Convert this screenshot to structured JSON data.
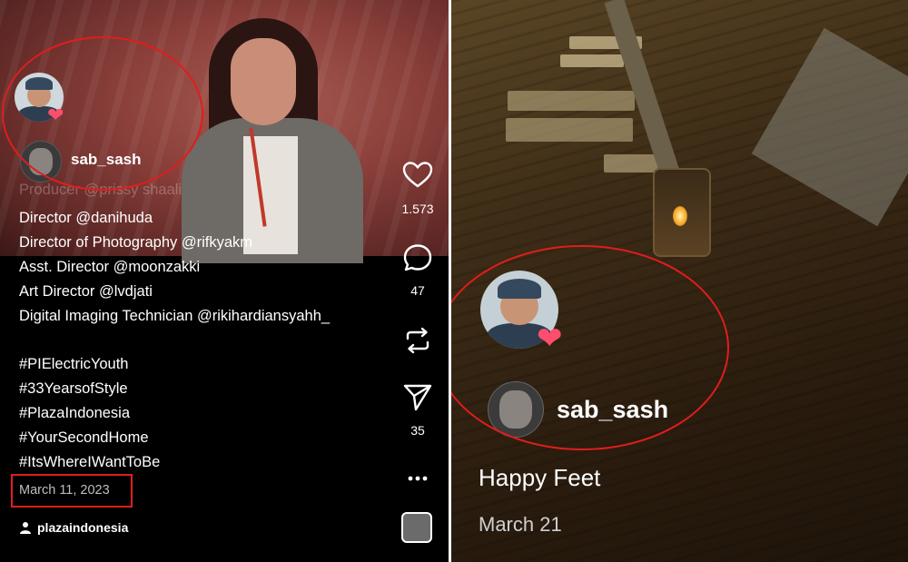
{
  "left_post": {
    "username": "sab_sash",
    "faded_credit": "Producer @prissy shaali",
    "credits": [
      "Director @danihuda",
      "Director of Photography @rifkyakm",
      "Asst. Director @moonzakki",
      "Art Director @lvdjati",
      "Digital Imaging Technician @rikihardiansyahh_"
    ],
    "hashtags": [
      "#PIElectricYouth",
      "#33YearsofStyle",
      "#PlazaIndonesia",
      "#YourSecondHome",
      "#ItsWhereIWantToBe"
    ],
    "date": "March 11, 2023",
    "tagged_account": "plazaindonesia",
    "like_count": "1.573",
    "comment_count": "47",
    "share_count": "35"
  },
  "right_post": {
    "username": "sab_sash",
    "caption": "Happy Feet",
    "date": "March 21"
  },
  "icons": [
    "heart-icon",
    "comment-icon",
    "repost-icon",
    "send-icon",
    "more-icon",
    "person-icon"
  ],
  "colors": {
    "highlight": "#e01d1d",
    "heart_badge": "#ff4d6d"
  }
}
